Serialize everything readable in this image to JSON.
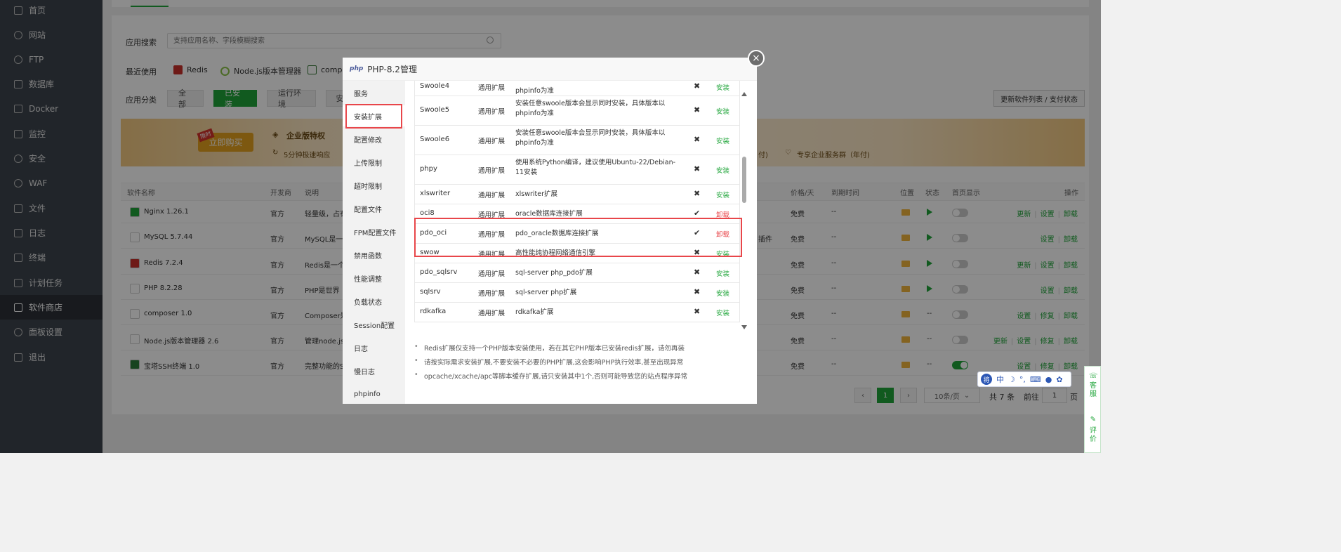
{
  "sidebar": {
    "items": [
      {
        "label": "首页",
        "icon": "home-icon"
      },
      {
        "label": "网站",
        "icon": "globe-icon"
      },
      {
        "label": "FTP",
        "icon": "ftp-icon"
      },
      {
        "label": "数据库",
        "icon": "database-icon"
      },
      {
        "label": "Docker",
        "icon": "docker-icon"
      },
      {
        "label": "监控",
        "icon": "monitor-icon"
      },
      {
        "label": "安全",
        "icon": "shield-icon"
      },
      {
        "label": "WAF",
        "icon": "waf-icon"
      },
      {
        "label": "文件",
        "icon": "folder-icon"
      },
      {
        "label": "日志",
        "icon": "log-icon"
      },
      {
        "label": "终端",
        "icon": "terminal-icon"
      },
      {
        "label": "计划任务",
        "icon": "clock-icon"
      },
      {
        "label": "软件商店",
        "icon": "grid-icon"
      },
      {
        "label": "面板设置",
        "icon": "gear-icon"
      },
      {
        "label": "退出",
        "icon": "logout-icon"
      }
    ],
    "active": "软件商店"
  },
  "store": {
    "search_label": "应用搜索",
    "search_placeholder": "支持应用名称、字段模糊搜索",
    "recent_label": "最近使用",
    "recent": [
      "Redis",
      "Node.js版本管理器",
      "comp"
    ],
    "category_label": "应用分类",
    "categories": [
      "全部",
      "已安装",
      "运行环境",
      "安"
    ],
    "active_category": "已安装",
    "update_button": "更新软件列表 / 支付状态",
    "banner": {
      "buy_tag": "限时",
      "buy_label": "立即购买",
      "title": "企业版特权",
      "feature1": "5分钟极速响应",
      "feature_cut": "付)",
      "feature2": "专享企业服务群（年付)"
    },
    "table_headers": [
      "软件名称",
      "开发商",
      "说明",
      "价格/天",
      "到期时间",
      "位置",
      "状态",
      "首页显示",
      "操作"
    ],
    "rows": [
      {
        "name": "Nginx 1.26.1",
        "vendor": "官方",
        "desc": "轻量级，占有",
        "extra": "",
        "price": "免费",
        "expire": "--",
        "ops": [
          "更新",
          "设置",
          "卸载"
        ],
        "toggle": false,
        "running": true
      },
      {
        "name": "MySQL 5.7.44",
        "vendor": "官方",
        "desc": "MySQL是一",
        "extra": "插件",
        "price": "免费",
        "expire": "--",
        "ops": [
          "设置",
          "卸载"
        ],
        "toggle": false,
        "running": true
      },
      {
        "name": "Redis 7.2.4",
        "vendor": "官方",
        "desc": "Redis是一个",
        "extra": "",
        "price": "免费",
        "expire": "--",
        "ops": [
          "更新",
          "设置",
          "卸载"
        ],
        "toggle": false,
        "running": true
      },
      {
        "name": "PHP 8.2.28",
        "vendor": "官方",
        "desc": "PHP是世界",
        "extra": "",
        "price": "免费",
        "expire": "--",
        "ops": [
          "设置",
          "卸载"
        ],
        "toggle": false,
        "running": true
      },
      {
        "name": "composer 1.0",
        "vendor": "官方",
        "desc": "Composer是",
        "extra": "",
        "price": "免费",
        "expire": "--",
        "status": "--",
        "ops": [
          "设置",
          "修复",
          "卸载"
        ],
        "toggle": false,
        "running": false
      },
      {
        "name": "Node.js版本管理器 2.6",
        "vendor": "官方",
        "desc": "管理node.js",
        "extra": "",
        "price": "免费",
        "expire": "--",
        "status": "--",
        "ops": [
          "更新",
          "设置",
          "修复",
          "卸载"
        ],
        "toggle": false,
        "running": false
      },
      {
        "name": "宝塔SSH终端 1.0",
        "vendor": "官方",
        "desc": "完整功能的S",
        "extra": "",
        "price": "免费",
        "expire": "--",
        "status": "--",
        "ops": [
          "设置",
          "修复",
          "卸载"
        ],
        "toggle": true,
        "running": false
      }
    ],
    "pager": {
      "current": "1",
      "per_page": "10条/页",
      "total": "共 7 条",
      "goto_label": "前往",
      "goto_value": "1",
      "page_suffix": "页"
    }
  },
  "modal": {
    "logo": "php",
    "title": "PHP-8.2管理",
    "close": "×",
    "nav": [
      "服务",
      "安装扩展",
      "配置修改",
      "上传限制",
      "超时限制",
      "配置文件",
      "FPM配置文件",
      "禁用函数",
      "性能调整",
      "负载状态",
      "Session配置",
      "日志",
      "慢日志",
      "phpinfo"
    ],
    "active_nav": "安装扩展",
    "extensions": [
      {
        "name": "Swoole4",
        "type": "通用扩展",
        "desc": "phpinfo为准",
        "installed": false,
        "action": "安装"
      },
      {
        "name": "Swoole5",
        "type": "通用扩展",
        "desc": "安装任意swoole版本会显示同时安装，具体版本以phpinfo为准",
        "installed": false,
        "action": "安装"
      },
      {
        "name": "Swoole6",
        "type": "通用扩展",
        "desc": "安装任意swoole版本会显示同时安装，具体版本以phpinfo为准",
        "installed": false,
        "action": "安装"
      },
      {
        "name": "phpy",
        "type": "通用扩展",
        "desc": "使用系统Python编译，建议使用Ubuntu-22/Debian-11安装",
        "installed": false,
        "action": "安装"
      },
      {
        "name": "xlswriter",
        "type": "通用扩展",
        "desc": "xlswriter扩展",
        "installed": false,
        "action": "安装"
      },
      {
        "name": "oci8",
        "type": "通用扩展",
        "desc": "oracle数据库连接扩展",
        "installed": true,
        "action": "卸载"
      },
      {
        "name": "pdo_oci",
        "type": "通用扩展",
        "desc": "pdo_oracle数据库连接扩展",
        "installed": true,
        "action": "卸载"
      },
      {
        "name": "swow",
        "type": "通用扩展",
        "desc": "高性能纯协程网络通信引擎",
        "installed": false,
        "action": "安装"
      },
      {
        "name": "pdo_sqlsrv",
        "type": "通用扩展",
        "desc": "sql-server php_pdo扩展",
        "installed": false,
        "action": "安装"
      },
      {
        "name": "sqlsrv",
        "type": "通用扩展",
        "desc": "sql-server php扩展",
        "installed": false,
        "action": "安装"
      },
      {
        "name": "rdkafka",
        "type": "通用扩展",
        "desc": "rdkafka扩展",
        "installed": false,
        "action": "安装"
      }
    ],
    "tips": [
      "Redis扩展仅支持一个PHP版本安装使用，若在其它PHP版本已安装redis扩展，请勿再装",
      "请按实际需求安装扩展,不要安装不必要的PHP扩展,这会影响PHP执行效率,甚至出现异常",
      "opcache/xcache/apc等脚本缓存扩展,请只安装其中1个,否则可能导致您的站点程序异常"
    ]
  },
  "ime": {
    "logo": "将",
    "mode": "中"
  },
  "float_help": {
    "service": "客服",
    "review": "评价"
  },
  "colors": {
    "accent": "#20a53a",
    "danger": "#e8464a",
    "sidebar": "#3c444d"
  }
}
